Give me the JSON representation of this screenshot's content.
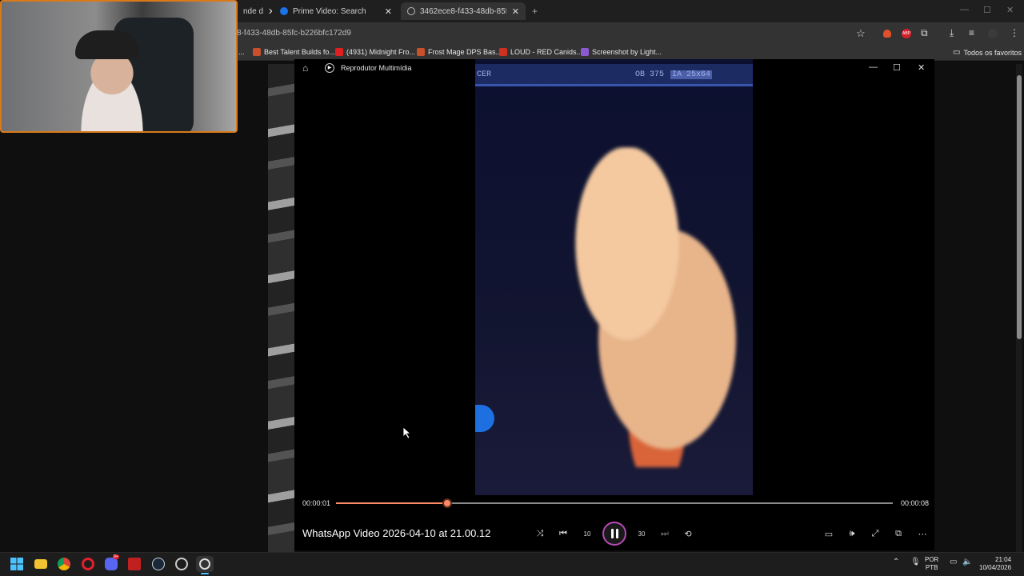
{
  "browser": {
    "tabs": [
      {
        "label": "nde d",
        "close": "✕"
      },
      {
        "label": "Prime Video: Search",
        "close": "✕"
      },
      {
        "label": "3462ece8-f433-48db-85fc-b226",
        "close": "✕"
      }
    ],
    "new_tab": "+",
    "url": "8-f433-48db-85fc-b226bfc172d9",
    "bookmarks": [
      {
        "label": "..."
      },
      {
        "label": "Best Talent Builds fo..."
      },
      {
        "label": "(4931) Midnight Fro..."
      },
      {
        "label": "Frost Mage DPS Bas..."
      },
      {
        "label": "LOUD - RED Canids..."
      },
      {
        "label": "Screenshot by Light..."
      }
    ],
    "all_bookmarks": "Todos os favoritos",
    "window_controls": {
      "minimize": "—",
      "maximize": "☐",
      "close": "✕"
    }
  },
  "player": {
    "app_name": "Reprodutor Multimídia",
    "window_controls": {
      "minimize": "—",
      "maximize": "☐",
      "close": "✕"
    },
    "video_overlay": {
      "left": "CER",
      "center": "OB 375",
      "right": "IA 25x64"
    },
    "current_time": "00:00:01",
    "total_time": "00:00:08",
    "progress_fraction": 0.2,
    "title": "WhatsApp Video 2026-04-10 at 21.00.12",
    "skip_back_label": "10",
    "skip_forward_label": "30"
  },
  "taskbar": {
    "language": "POR",
    "layout": "PTB",
    "time": "21:04",
    "date": "10/04/2026",
    "discord_badge": "9+"
  },
  "colors": {
    "accent": "#ff8a65",
    "play_ring": "#b54ab5",
    "webcam_border": "#d97a1a"
  }
}
